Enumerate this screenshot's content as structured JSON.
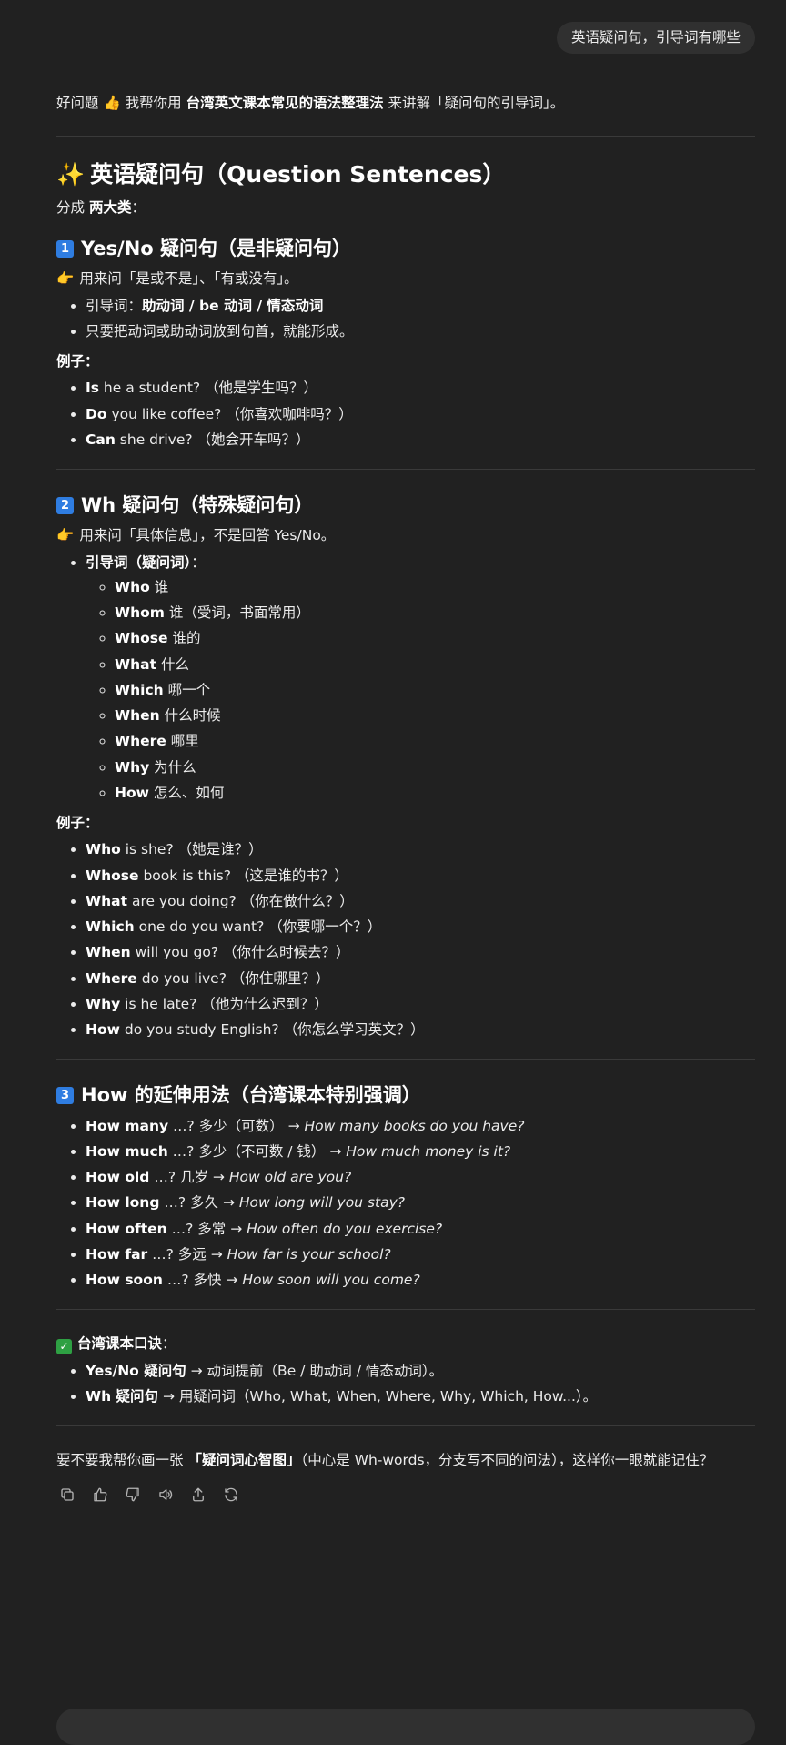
{
  "user_message": "英语疑问句，引导词有哪些",
  "intro": {
    "a": "好问题 ",
    "b": " 我帮你用 ",
    "bold": "台湾英文课本常见的语法整理法",
    "c": " 来讲解「疑问句的引导词」。"
  },
  "title": "英语疑问句（Question Sentences）",
  "subtitle": {
    "a": "分成 ",
    "bold": "两大类",
    "c": "："
  },
  "sections": {
    "yesno": {
      "num": "1",
      "heading": "Yes/No 疑问句（是非疑问句）",
      "desc": "用来问「是或不是」、「有或没有」。",
      "bullet1_a": "引导词：",
      "bullet1_b": "助动词 / be 动词 / 情态动词",
      "bullet2": "只要把动词或助动词放到句首，就能形成。",
      "examples_label": "例子：",
      "examples": [
        {
          "w": "Is",
          "t": " he a student? （他是学生吗？）"
        },
        {
          "w": "Do",
          "t": " you like coffee? （你喜欢咖啡吗？）"
        },
        {
          "w": "Can",
          "t": " she drive? （她会开车吗？）"
        }
      ]
    },
    "wh": {
      "num": "2",
      "heading": "Wh 疑问句（特殊疑问句）",
      "desc": "用来问「具体信息」，不是回答 Yes/No。",
      "words_label": "引导词（疑问词）",
      "words_colon": "：",
      "words": [
        {
          "w": "Who",
          "t": " 谁"
        },
        {
          "w": "Whom",
          "t": " 谁（受词，书面常用）"
        },
        {
          "w": "Whose",
          "t": " 谁的"
        },
        {
          "w": "What",
          "t": " 什么"
        },
        {
          "w": "Which",
          "t": " 哪一个"
        },
        {
          "w": "When",
          "t": " 什么时候"
        },
        {
          "w": "Where",
          "t": " 哪里"
        },
        {
          "w": "Why",
          "t": " 为什么"
        },
        {
          "w": "How",
          "t": " 怎么、如何"
        }
      ],
      "examples_label": "例子：",
      "examples": [
        {
          "w": "Who",
          "t": " is she? （她是谁？）"
        },
        {
          "w": "Whose",
          "t": " book is this? （这是谁的书？）"
        },
        {
          "w": "What",
          "t": " are you doing? （你在做什么？）"
        },
        {
          "w": "Which",
          "t": " one do you want? （你要哪一个？）"
        },
        {
          "w": "When",
          "t": " will you go? （你什么时候去？）"
        },
        {
          "w": "Where",
          "t": " do you live? （你住哪里？）"
        },
        {
          "w": "Why",
          "t": " is he late? （他为什么迟到？）"
        },
        {
          "w": "How",
          "t": " do you study English? （你怎么学习英文？）"
        }
      ]
    },
    "how": {
      "num": "3",
      "heading": "How 的延伸用法（台湾课本特别强调）",
      "items": [
        {
          "w": "How many",
          "t": " …? 多少（可数） → ",
          "ex": "How many books do you have?"
        },
        {
          "w": "How much",
          "t": " …? 多少（不可数 / 钱） → ",
          "ex": "How much money is it?"
        },
        {
          "w": "How old",
          "t": " …? 几岁 → ",
          "ex": "How old are you?"
        },
        {
          "w": "How long",
          "t": " …? 多久 → ",
          "ex": "How long will you stay?"
        },
        {
          "w": "How often",
          "t": " …? 多常 → ",
          "ex": "How often do you exercise?"
        },
        {
          "w": "How far",
          "t": " …? 多远 → ",
          "ex": "How far is your school?"
        },
        {
          "w": "How soon",
          "t": " …? 多快 → ",
          "ex": "How soon will you come?"
        }
      ]
    },
    "summary": {
      "label": "台湾课本口诀",
      "colon": "：",
      "items": [
        {
          "w": "Yes/No 疑问句",
          "t": " → 动词提前（Be / 助动词 / 情态动词）。"
        },
        {
          "w": "Wh 疑问句",
          "t": " → 用疑问词（Who, What, When, Where, Why, Which, How...）。"
        }
      ]
    }
  },
  "closing": {
    "a": "要不要我帮你画一张 ",
    "bold": "「疑问词心智图」",
    "c": "（中心是 Wh-words，分支写不同的问法），这样你一眼就能记住？"
  },
  "icons": {
    "thumb": "👍",
    "sparkle": "✨",
    "point": "👉",
    "check": "✓"
  },
  "colors": {
    "background": "#212121",
    "text": "#ececec",
    "bubble": "#303030",
    "number_badge": "#2f7de1",
    "check_badge": "#2ea043"
  }
}
